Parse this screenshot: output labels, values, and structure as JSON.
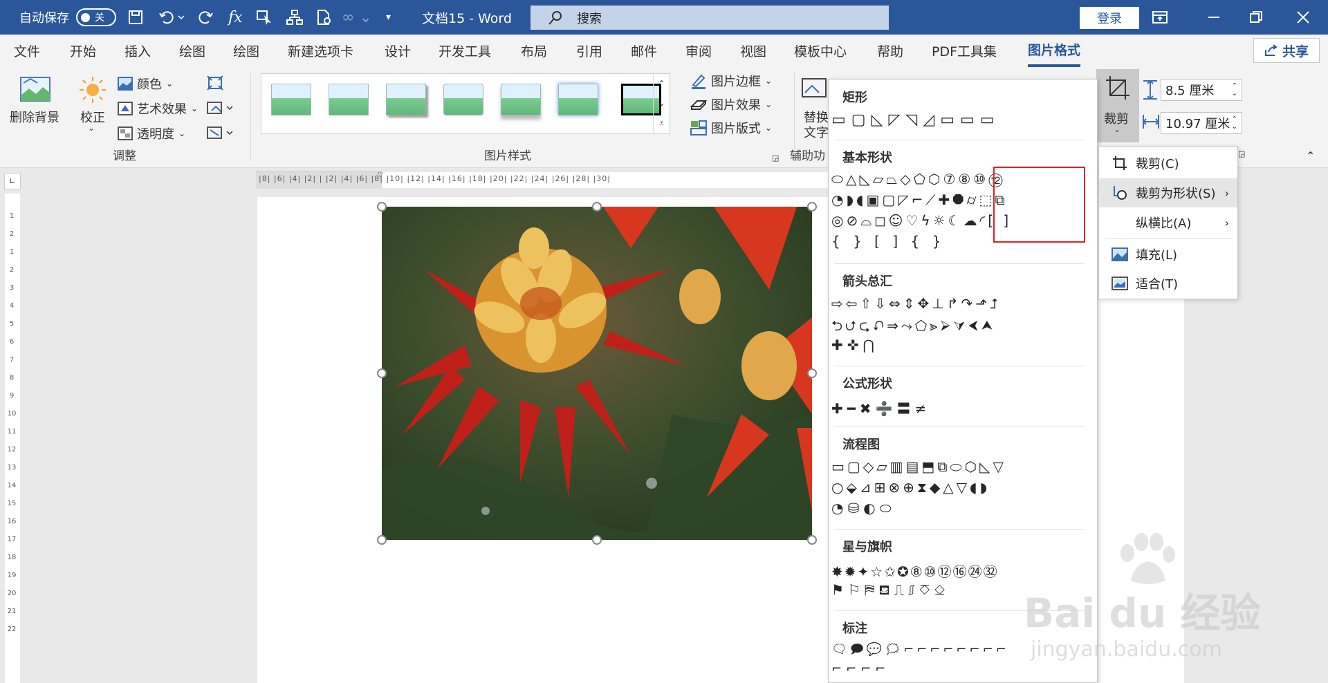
{
  "titlebar": {
    "autosave_label": "自动保存",
    "autosave_state": "关",
    "doc_title": "文档15 - Word",
    "search_placeholder": "搜索",
    "login_label": "登录"
  },
  "tabs": [
    "文件",
    "开始",
    "插入",
    "绘图",
    "绘图",
    "新建选项卡",
    "设计",
    "开发工具",
    "布局",
    "引用",
    "邮件",
    "审阅",
    "视图",
    "模板中心",
    "帮助",
    "PDF工具集",
    "图片格式"
  ],
  "share_label": "共享",
  "ribbon": {
    "remove_bg": "删除背景",
    "corrections": "校正",
    "color": "颜色",
    "artistic": "艺术效果",
    "transparency": "透明度",
    "group_adjust": "调整",
    "picture_border": "图片边框",
    "picture_effects": "图片效果",
    "picture_layout": "图片版式",
    "group_styles": "图片样式",
    "alt_text_1": "替换",
    "alt_text_2": "文字",
    "group_accessibility": "辅助功",
    "crop_label": "裁剪",
    "height_value": "8.5 厘米",
    "width_value": "10.97 厘米"
  },
  "ruler_top": "|8| |6| |4| |2| | |2| |4| |6| |8| |10| |12| |14| |16| |18| |20| |22| |24| |26| |28| |30|",
  "ruler_left": [
    "1",
    "2",
    "1",
    "2",
    "3",
    "4",
    "5",
    "6",
    "7",
    "8",
    "9",
    "10",
    "11",
    "12",
    "13",
    "14",
    "15",
    "16",
    "17",
    "18",
    "19",
    "20",
    "21",
    "22"
  ],
  "shapes_gallery": {
    "rect": "矩形",
    "basic": "基本形状",
    "arrows": "箭头总汇",
    "equation": "公式形状",
    "flowchart": "流程图",
    "stars": "星与旗帜",
    "callouts": "标注",
    "rect_row": "▭▢◺◸◹◿▭▭▭",
    "basic_rows": [
      "⬭△◺▱⏢◇⬠⬡⑦⑧⑩⑫",
      "◔◗◖▣▢◸⌐⟋✚⯃⌭⬚⧉",
      "◎⊘⌓◻☺♡ϟ☼☾☁◜[ ]",
      "{ } [ ] { }"
    ],
    "arrow_rows": [
      "⇨⇦⇧⇩⇔⇕✥⊥↱↷⬏⮥",
      "⮌⮍⮎⮏⇒⤳⬠⪢⮚⮛⮜⮝",
      "✚✜⋂"
    ],
    "equation_row": "✚━✖➗〓≠",
    "flow_rows": [
      "▭▢◇▱▥▤⬒⧉⬭⬡◺▽",
      "○⬙⊿⊞⊗⊕⧗◆△▽◖◗",
      "◔⛁◐⬭"
    ],
    "star_rows": [
      "✸✹✦☆✩✪⑧⑩⑫⑯㉔㉜",
      "⚑⚐⛿⛾⎍⎎⎏⎐"
    ],
    "callout_rows": [
      "🗨🗩💬🗯⌐⌐⌐⌐⌐⌐⌐⌐",
      "⌐⌐⌐⌐"
    ]
  },
  "crop_menu": {
    "crop": "裁剪(C)",
    "crop_to_shape": "裁剪为形状(S)",
    "aspect_ratio": "纵横比(A)",
    "fill": "填充(L)",
    "fit": "适合(T)"
  },
  "watermark": {
    "brand": "Bai du 经验",
    "url": "jingyan.baidu.com"
  },
  "colors": {
    "title_bar": "#2b579a",
    "highlight_box": "#e02020",
    "menu_hover": "#e5e5e5"
  }
}
